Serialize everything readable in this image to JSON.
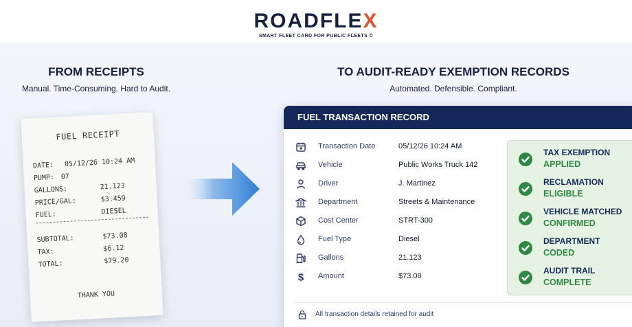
{
  "brand": {
    "logo_main": "ROADFLE",
    "logo_accent": "X",
    "tagline": "SMART FLEET CARD FOR PUBLIC FLEETS ©"
  },
  "left": {
    "title": "FROM RECEIPTS",
    "subtitle": "Manual. Time-Consuming. Hard to Audit."
  },
  "receipt": {
    "title": "FUEL RECEIPT",
    "lines": [
      {
        "key": "DATE:",
        "value": "05/12/26 10:24 AM"
      },
      {
        "key": "PUMP:",
        "value": "07"
      },
      {
        "key": "GALLONS:",
        "value": "21.123"
      },
      {
        "key": "PRICE/GAL:",
        "value": "$3.459"
      },
      {
        "key": "FUEL:",
        "value": "DIESEL"
      },
      {
        "key": "SUBTOTAL:",
        "value": "$73.08"
      },
      {
        "key": "TAX:",
        "value": "$6.12"
      },
      {
        "key": "TOTAL:",
        "value": "$79.20"
      }
    ],
    "footer": "THANK YOU"
  },
  "right": {
    "title": "TO AUDIT-READY EXEMPTION RECORDS",
    "subtitle": "Automated. Defensible. Compliant."
  },
  "record": {
    "header": "FUEL TRANSACTION RECORD",
    "fields": [
      {
        "icon": "calendar-icon",
        "label": "Transaction Date",
        "value": "05/12/26 10:24 AM"
      },
      {
        "icon": "car-icon",
        "label": "Vehicle",
        "value": "Public Works Truck 142"
      },
      {
        "icon": "person-icon",
        "label": "Driver",
        "value": "J. Martinez"
      },
      {
        "icon": "building-icon",
        "label": "Department",
        "value": "Streets & Maintenance"
      },
      {
        "icon": "cube-icon",
        "label": "Cost Center",
        "value": "STRT-300"
      },
      {
        "icon": "droplet-icon",
        "label": "Fuel Type",
        "value": "Diesel"
      },
      {
        "icon": "fuel-pump-icon",
        "label": "Gallons",
        "value": "21.123"
      },
      {
        "icon": "dollar-icon",
        "label": "Amount",
        "value": "$73.08"
      }
    ],
    "statuses": [
      {
        "line1": "TAX EXEMPTION",
        "line2": "APPLIED"
      },
      {
        "line1": "RECLAMATION",
        "line2": "ELIGIBLE"
      },
      {
        "line1": "VEHICLE MATCHED",
        "line2": "CONFIRMED"
      },
      {
        "line1": "DEPARTMENT",
        "line2": "CODED"
      },
      {
        "line1": "AUDIT TRAIL",
        "line2": "COMPLETE"
      }
    ],
    "footer": "All transaction details retained for audit",
    "footer_icon": "lock-icon"
  },
  "colors": {
    "navy": "#15285a",
    "accent_orange": "#e0542a",
    "success_green": "#2e8a43",
    "status_bg": "#e6f2e4",
    "arrow_blue": "#2f7fd6"
  }
}
